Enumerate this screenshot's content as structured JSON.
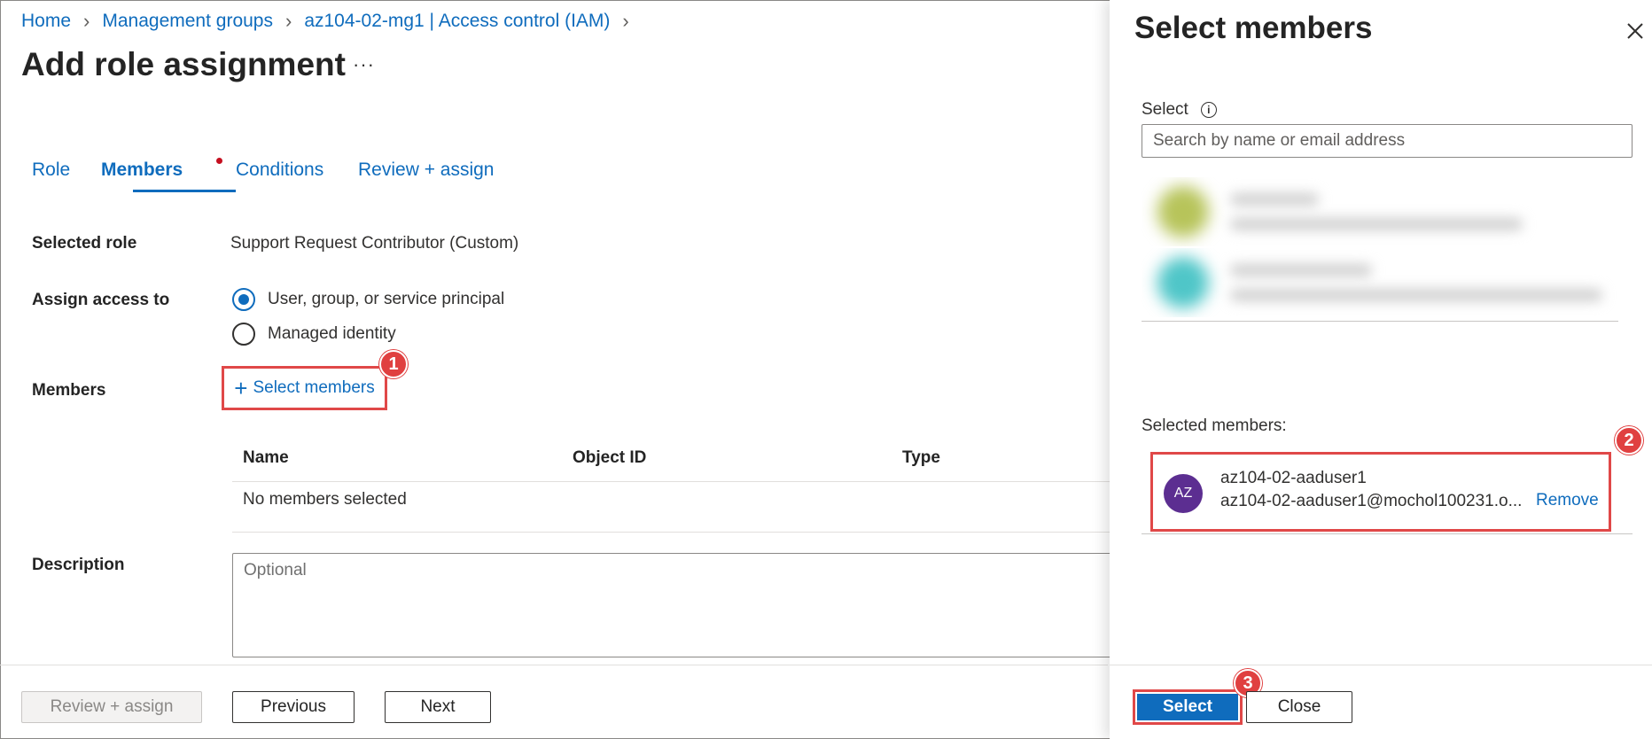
{
  "breadcrumb": {
    "items": [
      "Home",
      "Management groups",
      "az104-02-mg1 | Access control (IAM)"
    ],
    "separator": ">"
  },
  "page": {
    "title": "Add role assignment",
    "more_label": "···"
  },
  "tabs": [
    {
      "label": "Role",
      "active": false
    },
    {
      "label": "Members",
      "active": true
    },
    {
      "label": "Conditions",
      "active": false
    },
    {
      "label": "Review + assign",
      "active": false
    }
  ],
  "form": {
    "selected_role_label": "Selected role",
    "selected_role_value": "Support Request Contributor (Custom)",
    "assign_access_label": "Assign access to",
    "assign_options": [
      {
        "label": "User, group, or service principal",
        "checked": true
      },
      {
        "label": "Managed identity",
        "checked": false
      }
    ],
    "members_label": "Members",
    "select_members_link": "Select members",
    "table_headers": [
      "Name",
      "Object ID",
      "Type"
    ],
    "table_empty": "No members selected",
    "description_label": "Description",
    "description_placeholder": "Optional"
  },
  "footer": {
    "review_assign": "Review + assign",
    "previous": "Previous",
    "next": "Next"
  },
  "panel": {
    "title": "Select members",
    "select_label": "Select",
    "search_placeholder": "Search by name or email address",
    "selected_members_label": "Selected members:",
    "member": {
      "initials": "AZ",
      "name": "az104-02-aaduser1",
      "email": "az104-02-aaduser1@mochol100231.o...",
      "remove_label": "Remove"
    },
    "select_button": "Select",
    "close_button": "Close"
  },
  "callouts": [
    "1",
    "2",
    "3"
  ],
  "colors": {
    "accent": "#0f6cbd",
    "highlight": "#e04848",
    "avatar": "#5c2e91"
  }
}
